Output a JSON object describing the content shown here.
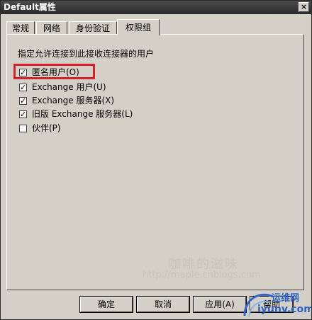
{
  "window": {
    "title": "Default属性",
    "close_glyph": "×"
  },
  "tabs": [
    {
      "label": "常规"
    },
    {
      "label": "网络"
    },
    {
      "label": "身份验证"
    },
    {
      "label": "权限组"
    }
  ],
  "panel": {
    "description": "指定允许连接到此接收连接器的用户",
    "options": [
      {
        "label": "匿名用户(O)",
        "checked": true
      },
      {
        "label": "Exchange 用户(U)",
        "checked": true
      },
      {
        "label": "Exchange 服务器(X)",
        "checked": true
      },
      {
        "label": "旧版 Exchange 服务器(L)",
        "checked": true
      },
      {
        "label": "伙伴(P)",
        "checked": false
      }
    ]
  },
  "buttons": {
    "ok": "确定",
    "cancel": "取消",
    "apply": "应用(A)",
    "help": "帮助"
  },
  "watermark": {
    "title": "咖啡的滋味",
    "url": "http://maple.cnblogs.com"
  },
  "logo": {
    "line1": "运维网",
    "line2": "iyunv.com"
  },
  "colors": {
    "highlight": "#d6202a",
    "dialog_bg": "#d4d0c8",
    "logo": "#2a63c8"
  }
}
